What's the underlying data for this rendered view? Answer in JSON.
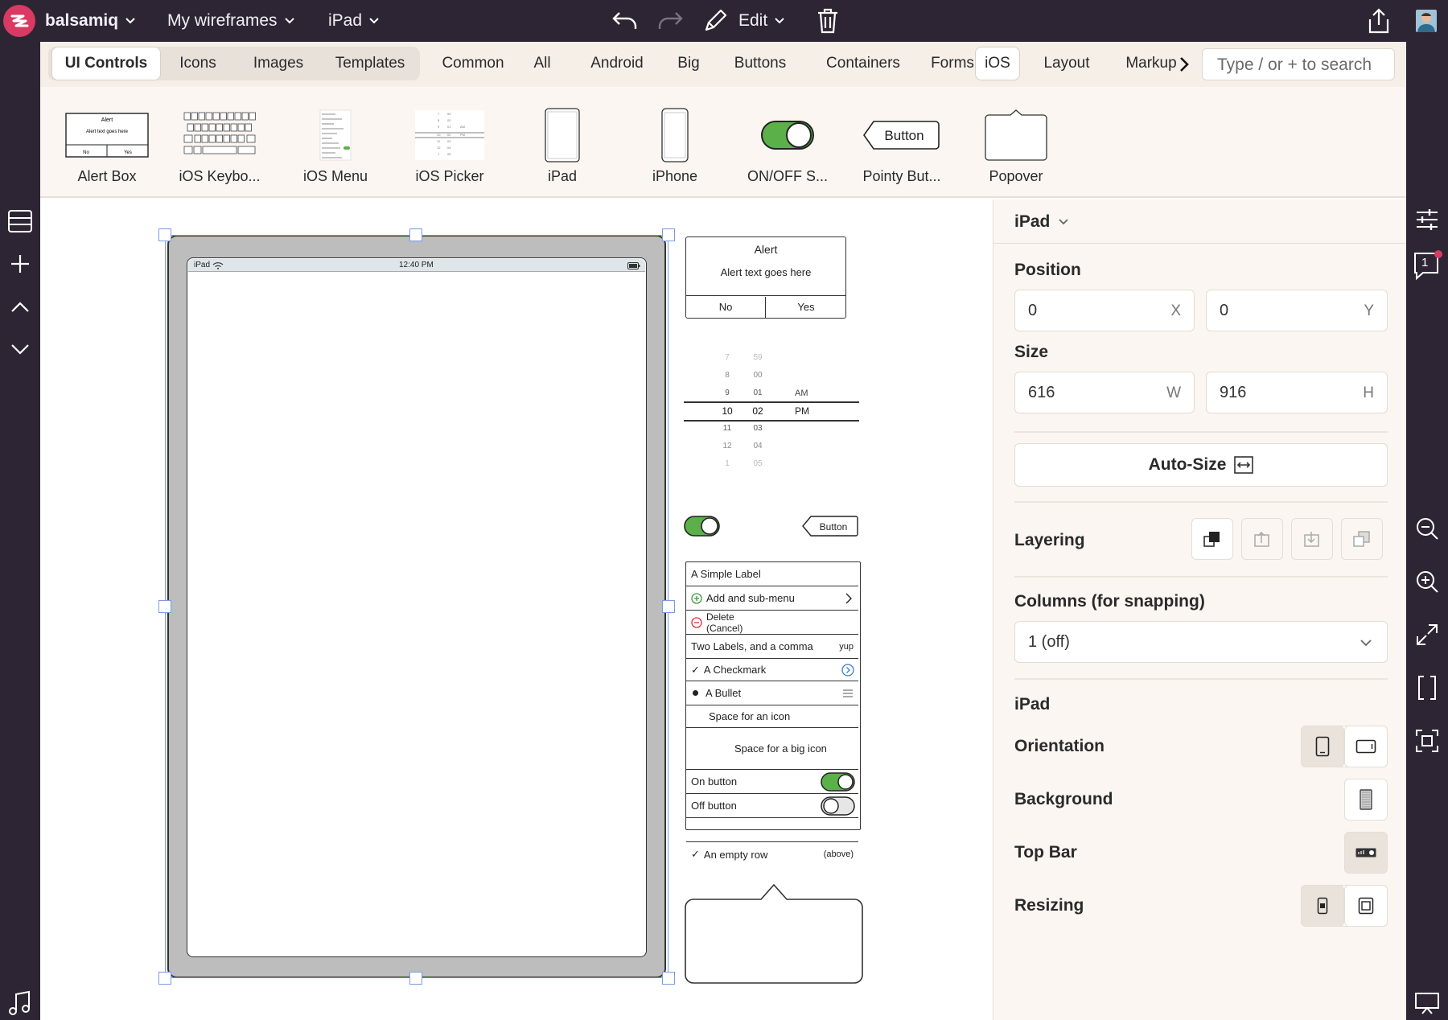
{
  "app": {
    "name": "balsamiq",
    "project": "My wireframes",
    "document": "iPad",
    "mode": "Edit"
  },
  "colors": {
    "chrome": "#2d2533",
    "accent": "#d93a63",
    "panel": "#fbf6f1",
    "toggle_green": "#5bb04a",
    "selection": "#7a9ae8"
  },
  "library": {
    "mode_tabs": [
      "UI Controls",
      "Icons",
      "Images",
      "Templates"
    ],
    "category_tabs": [
      "Common",
      "All",
      "Android",
      "Big",
      "Buttons",
      "Containers",
      "Forms",
      "iOS",
      "Layout",
      "Markup"
    ],
    "selected_category": "iOS",
    "search_placeholder": "Type / or + to search",
    "components": [
      "Alert Box",
      "iOS Keybo...",
      "iOS Menu",
      "iOS Picker",
      "iPad",
      "iPhone",
      "ON/OFF S...",
      "Pointy But...",
      "Popover"
    ]
  },
  "canvas": {
    "ipad": {
      "carrier": "iPad",
      "time": "12:40 PM"
    },
    "alert": {
      "title": "Alert",
      "text": "Alert text goes here",
      "no": "No",
      "yes": "Yes"
    },
    "picker": {
      "hours": [
        "7",
        "8",
        "9",
        "10",
        "11",
        "12",
        "1"
      ],
      "minutes": [
        "59",
        "00",
        "01",
        "02",
        "03",
        "04",
        "05"
      ],
      "ampm": [
        "AM",
        "PM"
      ]
    },
    "pointy_button": "Button",
    "alert_thumb_button": "Button",
    "menu": {
      "simple_label": "A Simple Label",
      "add_submenu": "Add and sub-menu",
      "delete_line1": "Delete",
      "delete_line2": "(Cancel)",
      "two_labels": "Two Labels, and a comma",
      "two_labels_right": "yup",
      "checkmark": "A Checkmark",
      "bullet": "A Bullet",
      "space_icon": "Space for an icon",
      "space_big_icon": "Space for a big icon",
      "on_button": "On button",
      "off_button": "Off button",
      "empty_row": "An empty row",
      "empty_row_right": "(above)"
    }
  },
  "inspector": {
    "title": "iPad",
    "position_label": "Position",
    "x": "0",
    "x_unit": "X",
    "y": "0",
    "y_unit": "Y",
    "size_label": "Size",
    "w": "616",
    "w_unit": "W",
    "h": "916",
    "h_unit": "H",
    "autosize": "Auto-Size",
    "layering": "Layering",
    "columns_label": "Columns (for snapping)",
    "columns_value": "1 (off)",
    "section": "iPad",
    "orientation": "Orientation",
    "background": "Background",
    "top_bar": "Top Bar",
    "resizing": "Resizing"
  },
  "right_rail": {
    "comments_count": "1"
  }
}
